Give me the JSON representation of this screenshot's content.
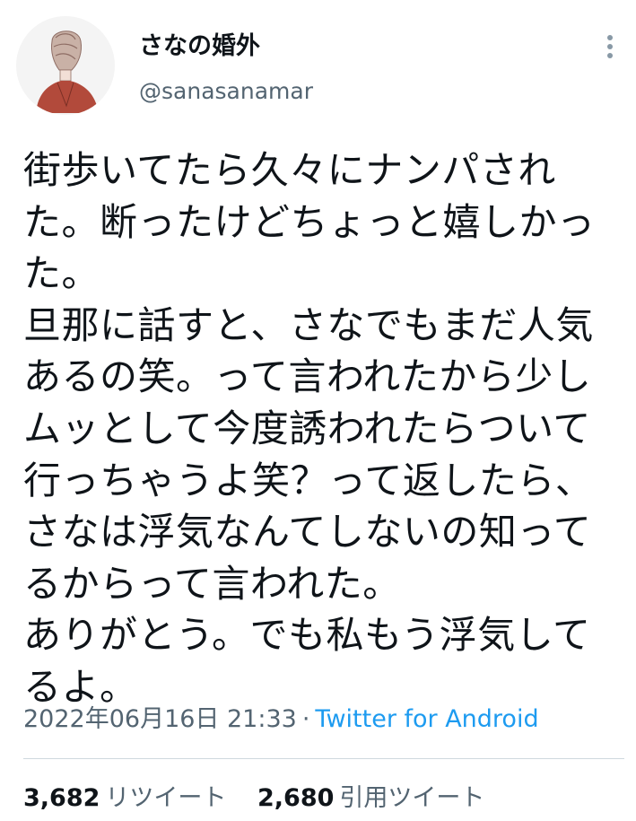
{
  "author": {
    "display_name": "さなの婚外",
    "handle": "@sanasanamar",
    "avatar_icon": "woman-back-illustration-icon"
  },
  "menu": {
    "icon": "more-vertical-icon"
  },
  "tweet": {
    "text": "街歩いてたら久々にナンパされた。断ったけどちょっと嬉しかった。\n旦那に話すと、さなでもまだ人気あるの笑。って言われたから少しムッとして今度誘われたらついて行っちゃうよ笑？って返したら、さなは浮気なんてしないの知ってるからって言われた。\nありがとう。でも私もう浮気してるよ。",
    "timestamp": "2022年06月16日 21:33",
    "separator": "·",
    "source": "Twitter for Android"
  },
  "stats": {
    "retweets": {
      "count": "3,682",
      "label": "リツイート"
    },
    "quotes": {
      "count": "2,680",
      "label": "引用ツイート"
    }
  },
  "colors": {
    "text_primary": "#0f1419",
    "text_secondary": "#536471",
    "link": "#1d9bf0",
    "divider": "#cfd9de"
  }
}
